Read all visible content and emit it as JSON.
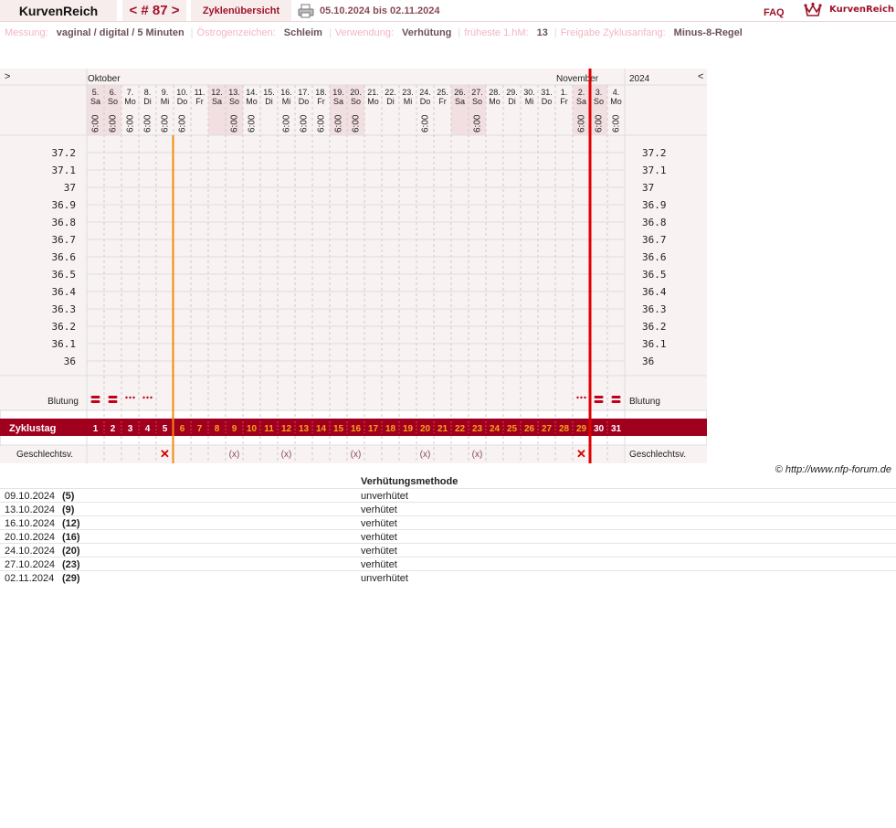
{
  "app": {
    "brand": "KurvenReich",
    "cycle_nav": "< # 87 >",
    "cycle_overview": "Zyklenübersicht",
    "date_range": "05.10.2024 bis 02.11.2024",
    "faq": "FAQ",
    "logo_text": "KurvenReich"
  },
  "meta": [
    {
      "label": "Messung:",
      "value": "vaginal / digital / 5 Minuten"
    },
    {
      "label": "Östrogenzeichen:",
      "value": "Schleim"
    },
    {
      "label": "Verwendung:",
      "value": "Verhütung"
    },
    {
      "label": "früheste 1.hM:",
      "value": "13"
    },
    {
      "label": "Freigabe Zyklusanfang:",
      "value": "Minus-8-Regel"
    }
  ],
  "chart_data": {
    "type": "table",
    "nav_prev": ">",
    "nav_next": "<",
    "months": [
      {
        "label": "Oktober",
        "start_index": 0
      },
      {
        "label": "November",
        "start_index": 27
      }
    ],
    "year": "2024",
    "days": [
      {
        "d": "5.",
        "wd": "Sa",
        "time": "6:00"
      },
      {
        "d": "6.",
        "wd": "So",
        "time": "6:00"
      },
      {
        "d": "7.",
        "wd": "Mo",
        "time": "6:00"
      },
      {
        "d": "8.",
        "wd": "Di",
        "time": "6:00"
      },
      {
        "d": "9.",
        "wd": "Mi",
        "time": "6:00"
      },
      {
        "d": "10.",
        "wd": "Do",
        "time": "6:00"
      },
      {
        "d": "11.",
        "wd": "Fr",
        "time": ""
      },
      {
        "d": "12.",
        "wd": "Sa",
        "time": ""
      },
      {
        "d": "13.",
        "wd": "So",
        "time": "6:00"
      },
      {
        "d": "14.",
        "wd": "Mo",
        "time": "6:00"
      },
      {
        "d": "15.",
        "wd": "Di",
        "time": ""
      },
      {
        "d": "16.",
        "wd": "Mi",
        "time": "6:00"
      },
      {
        "d": "17.",
        "wd": "Do",
        "time": "6:00"
      },
      {
        "d": "18.",
        "wd": "Fr",
        "time": "6:00"
      },
      {
        "d": "19.",
        "wd": "Sa",
        "time": "6:00"
      },
      {
        "d": "20.",
        "wd": "So",
        "time": "6:00"
      },
      {
        "d": "21.",
        "wd": "Mo",
        "time": ""
      },
      {
        "d": "22.",
        "wd": "Di",
        "time": ""
      },
      {
        "d": "23.",
        "wd": "Mi",
        "time": ""
      },
      {
        "d": "24.",
        "wd": "Do",
        "time": "6:00"
      },
      {
        "d": "25.",
        "wd": "Fr",
        "time": ""
      },
      {
        "d": "26.",
        "wd": "Sa",
        "time": ""
      },
      {
        "d": "27.",
        "wd": "So",
        "time": "6:00"
      },
      {
        "d": "28.",
        "wd": "Mo",
        "time": ""
      },
      {
        "d": "29.",
        "wd": "Di",
        "time": ""
      },
      {
        "d": "30.",
        "wd": "Mi",
        "time": ""
      },
      {
        "d": "31.",
        "wd": "Do",
        "time": ""
      },
      {
        "d": "1.",
        "wd": "Fr",
        "time": ""
      },
      {
        "d": "2.",
        "wd": "Sa",
        "time": "6:00"
      },
      {
        "d": "3.",
        "wd": "So",
        "time": "6:00"
      },
      {
        "d": "4.",
        "wd": "Mo",
        "time": "6:00"
      }
    ],
    "temp_ticks": [
      "37.2",
      "37.1",
      "37",
      "36.9",
      "36.8",
      "36.7",
      "36.6",
      "36.5",
      "36.4",
      "36.3",
      "36.2",
      "36.1",
      "36"
    ],
    "bleeding_label": "Blutung",
    "bleeding": [
      "heavy",
      "heavy",
      "light",
      "light",
      "",
      "",
      "",
      "",
      "",
      "",
      "",
      "",
      "",
      "",
      "",
      "",
      "",
      "",
      "",
      "",
      "",
      "",
      "",
      "",
      "",
      "",
      "",
      "",
      "light",
      "heavy",
      "heavy"
    ],
    "cycle_day_label": "Zyklustag",
    "cycle_days": [
      "1",
      "2",
      "3",
      "4",
      "5",
      "6",
      "7",
      "8",
      "9",
      "10",
      "11",
      "12",
      "13",
      "14",
      "15",
      "16",
      "17",
      "18",
      "19",
      "20",
      "21",
      "22",
      "23",
      "24",
      "25",
      "26",
      "27",
      "28",
      "29",
      "30",
      "31"
    ],
    "intercourse_label": "Geschlechtsv.",
    "intercourse": [
      "",
      "",
      "",
      "",
      "x",
      "",
      "",
      "",
      "(x)",
      "",
      "",
      "(x)",
      "",
      "",
      "",
      "(x)",
      "",
      "",
      "",
      "(x)",
      "",
      "",
      "(x)",
      "",
      "",
      "",
      "",
      "",
      "x",
      "",
      ""
    ],
    "marker_orange_index": 5,
    "marker_red_index": 29,
    "colors": {
      "accent": "#a0001e",
      "orange": "#f38a0c",
      "red_line": "#e00000",
      "weekend": "#f2dfe2",
      "cell_bg": "#f8f2f2"
    }
  },
  "copyright": "© http://www.nfp-forum.de",
  "sex_table": {
    "header": "Verhütungsmethode",
    "rows": [
      {
        "date": "09.10.2024",
        "day": "(5)",
        "method": "unverhütet"
      },
      {
        "date": "13.10.2024",
        "day": "(9)",
        "method": "verhütet"
      },
      {
        "date": "16.10.2024",
        "day": "(12)",
        "method": "verhütet"
      },
      {
        "date": "20.10.2024",
        "day": "(16)",
        "method": "verhütet"
      },
      {
        "date": "24.10.2024",
        "day": "(20)",
        "method": "verhütet"
      },
      {
        "date": "27.10.2024",
        "day": "(23)",
        "method": "verhütet"
      },
      {
        "date": "02.11.2024",
        "day": "(29)",
        "method": "unverhütet"
      }
    ]
  }
}
